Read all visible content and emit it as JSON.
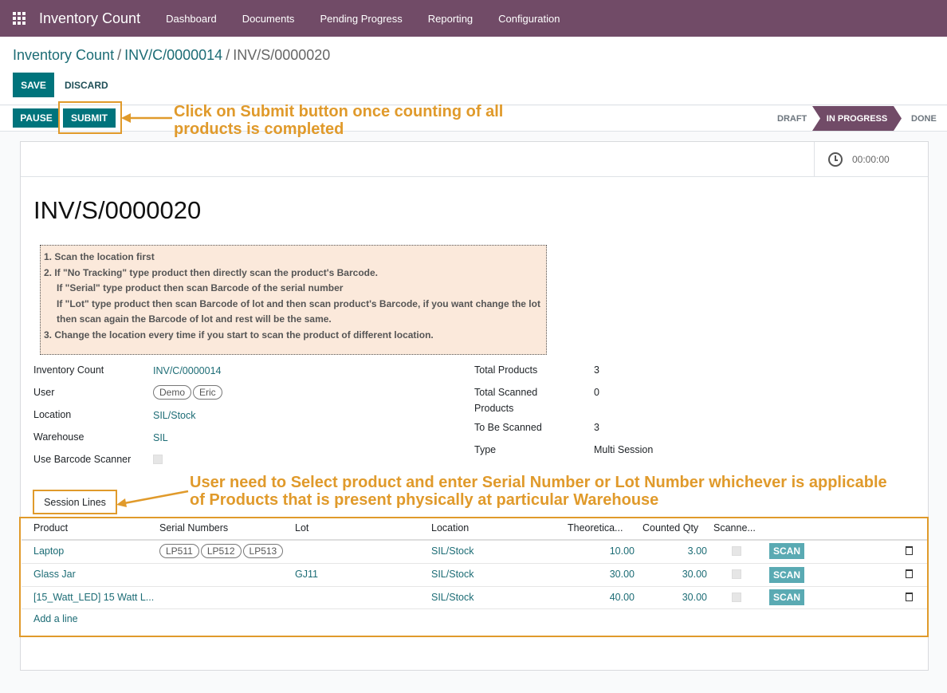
{
  "app": {
    "title": "Inventory Count"
  },
  "nav": [
    {
      "label": "Dashboard"
    },
    {
      "label": "Documents"
    },
    {
      "label": "Pending Progress"
    },
    {
      "label": "Reporting"
    },
    {
      "label": "Configuration"
    }
  ],
  "breadcrumb": {
    "root": "Inventory Count",
    "parent": "INV/C/0000014",
    "current": "INV/S/0000020",
    "sep": "/"
  },
  "buttons": {
    "save": "SAVE",
    "discard": "DISCARD",
    "pause": "PAUSE",
    "submit": "SUBMIT",
    "scan": "SCAN"
  },
  "stages": {
    "draft": "DRAFT",
    "in_progress": "IN PROGRESS",
    "done": "DONE"
  },
  "annotations": {
    "submit": "Click on Submit button once counting of all products is completed",
    "session": "User need to Select product and enter Serial Number or Lot Number whichever is applicable of Products that is present physically at particular Warehouse"
  },
  "timer": "00:00:00",
  "record_title": "INV/S/0000020",
  "instructions": [
    "1. Scan the location first",
    "2. If \"No Tracking\" type product then directly scan the product's Barcode.",
    "If \"Serial\" type product then scan Barcode of the serial number",
    "If \"Lot\" type product then scan Barcode of lot and then scan product's Barcode, if you want change the lot",
    "then scan again the Barcode of lot and rest will be the same.",
    "3. Change the location every time if you start to scan the product of different location."
  ],
  "fields": {
    "inventory_count": {
      "label": "Inventory Count",
      "value": "INV/C/0000014"
    },
    "user": {
      "label": "User",
      "tags": [
        "Demo",
        "Eric"
      ]
    },
    "location": {
      "label": "Location",
      "value": "SIL/Stock"
    },
    "warehouse": {
      "label": "Warehouse",
      "value": "SIL"
    },
    "barcode": {
      "label": "Use Barcode Scanner"
    },
    "total_products": {
      "label": "Total Products",
      "value": "3"
    },
    "total_scanned": {
      "label_1": "Total Scanned",
      "label_2": "Products",
      "value": "0"
    },
    "to_be_scanned": {
      "label": "To Be Scanned",
      "value": "3"
    },
    "type": {
      "label": "Type",
      "value": "Multi Session"
    }
  },
  "tab": {
    "session_lines": "Session Lines"
  },
  "table": {
    "headers": [
      "Product",
      "Serial Numbers",
      "Lot",
      "Location",
      "Theoretica...",
      "Counted Qty",
      "Scanne..."
    ],
    "rows": [
      {
        "product": "Laptop",
        "serials": [
          "LP511",
          "LP512",
          "LP513"
        ],
        "lot": "",
        "location": "SIL/Stock",
        "theoretical": "10.00",
        "counted": "3.00"
      },
      {
        "product": "Glass Jar",
        "serials": [],
        "lot": "GJ11",
        "location": "SIL/Stock",
        "theoretical": "30.00",
        "counted": "30.00"
      },
      {
        "product": "[15_Watt_LED] 15 Watt L...",
        "serials": [],
        "lot": "",
        "location": "SIL/Stock",
        "theoretical": "40.00",
        "counted": "30.00"
      }
    ],
    "add_line": "Add a line"
  }
}
